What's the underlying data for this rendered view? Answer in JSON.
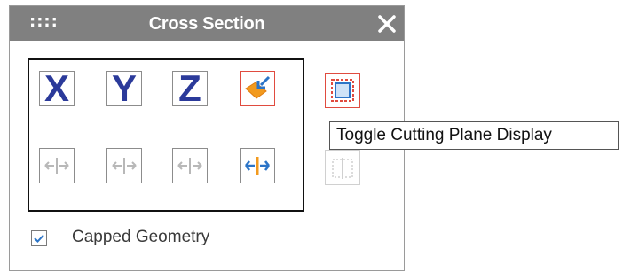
{
  "panel": {
    "grip_glyph": "::::",
    "title": "Cross Section",
    "close_label": "Close"
  },
  "axes": [
    {
      "label": "X",
      "color": "#2b3a9a"
    },
    {
      "label": "Y",
      "color": "#2b3a9a"
    },
    {
      "label": "Z",
      "color": "#2b3a9a"
    }
  ],
  "buttons": {
    "custom_plane": {
      "icon": "custom-plane-icon",
      "active": true,
      "color": "#e04b3f"
    },
    "toggle_plane_display": {
      "icon": "plane-display-icon",
      "active": true,
      "color": "#e04b3f"
    },
    "flip_x": {
      "icon": "flip-icon",
      "active": false
    },
    "flip_y": {
      "icon": "flip-icon",
      "active": false
    },
    "flip_z": {
      "icon": "flip-icon",
      "active": false
    },
    "flip_custom": {
      "icon": "flip-icon",
      "active": true
    },
    "reset_plane": {
      "icon": "reset-plane-icon",
      "active": false
    }
  },
  "capped_geometry": {
    "label": "Capped Geometry",
    "checked": true
  },
  "tooltip": {
    "text": "Toggle Cutting Plane Display"
  },
  "colors": {
    "titlebar": "#808080",
    "axis_blue": "#2b3a9a",
    "accent_red": "#e04b3f",
    "accent_orange": "#f29a1e",
    "icon_blue": "#2b74c7",
    "disabled_gray": "#b8b8b8"
  }
}
